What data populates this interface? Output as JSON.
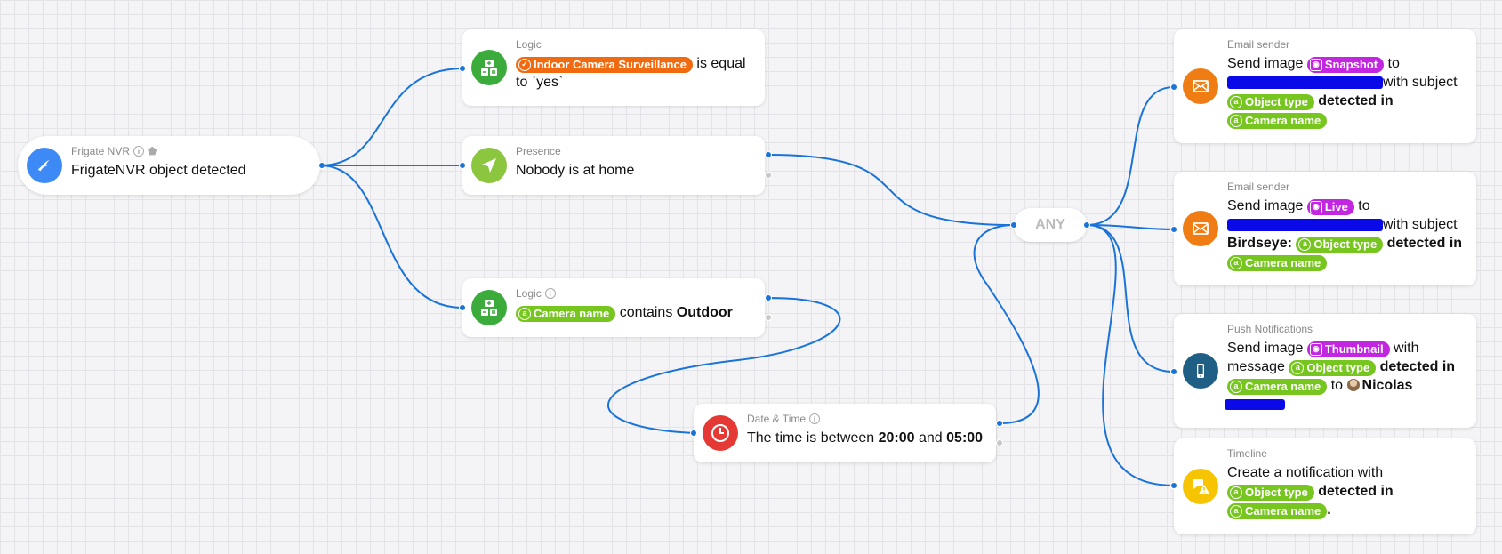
{
  "nodes": {
    "trigger": {
      "category": "Frigate NVR",
      "text": "FrigateNVR object detected"
    },
    "logic_indoor": {
      "category": "Logic",
      "token": "Indoor Camera Surveillance",
      "after": " is equal to `yes`"
    },
    "presence": {
      "category": "Presence",
      "text": "Nobody is at home"
    },
    "logic_outdoor": {
      "category": "Logic",
      "token": "Camera name",
      "mid": " contains ",
      "bold": "Outdoor"
    },
    "datetime": {
      "category": "Date & Time",
      "t1": "The time is between ",
      "b1": "20:00",
      "t2": " and ",
      "b2": "05:00"
    },
    "any": {
      "label": "ANY"
    },
    "email1": {
      "category": "Email sender",
      "t1": "Send image ",
      "tok1": "Snapshot",
      "t2": " to",
      "t3": "with subject",
      "tok2": "Object type",
      "t4": " detected in",
      "tok3": "Camera name"
    },
    "email2": {
      "category": "Email sender",
      "t1": "Send image ",
      "tok1": "Live",
      "t2": " to",
      "t3": "with subject",
      "b1": "Birdseye: ",
      "tok2": "Object type",
      "t4": " detected in",
      "tok3": "Camera name"
    },
    "push": {
      "category": "Push Notifications",
      "t1": "Send image ",
      "tok1": "Thumbnail",
      "t2": " with",
      "t3": "message ",
      "tok2": "Object type",
      "t4": " detected in",
      "tok3": "Camera name",
      "t5": " to ",
      "user": "Nicolas"
    },
    "timeline": {
      "category": "Timeline",
      "t1": "Create a notification with",
      "tok1": "Object type",
      "t2": " detected in",
      "tok2": "Camera name",
      "t3": "."
    }
  },
  "colors": {
    "wire": "#1a73d9",
    "frigate": "#3d8af7",
    "logic": "#3bab3b",
    "presence": "#8cc63f",
    "datetime": "#e53935",
    "email": "#f07c14",
    "push": "#1f5f86",
    "timeline": "#f6c400"
  },
  "icons": {
    "trigger": "frigate-bird-icon",
    "logic": "logic-calculator-icon",
    "presence": "location-arrow-icon",
    "datetime": "clock-icon",
    "email": "envelope-icon",
    "push": "smartphone-icon",
    "timeline": "timeline-alert-icon"
  }
}
